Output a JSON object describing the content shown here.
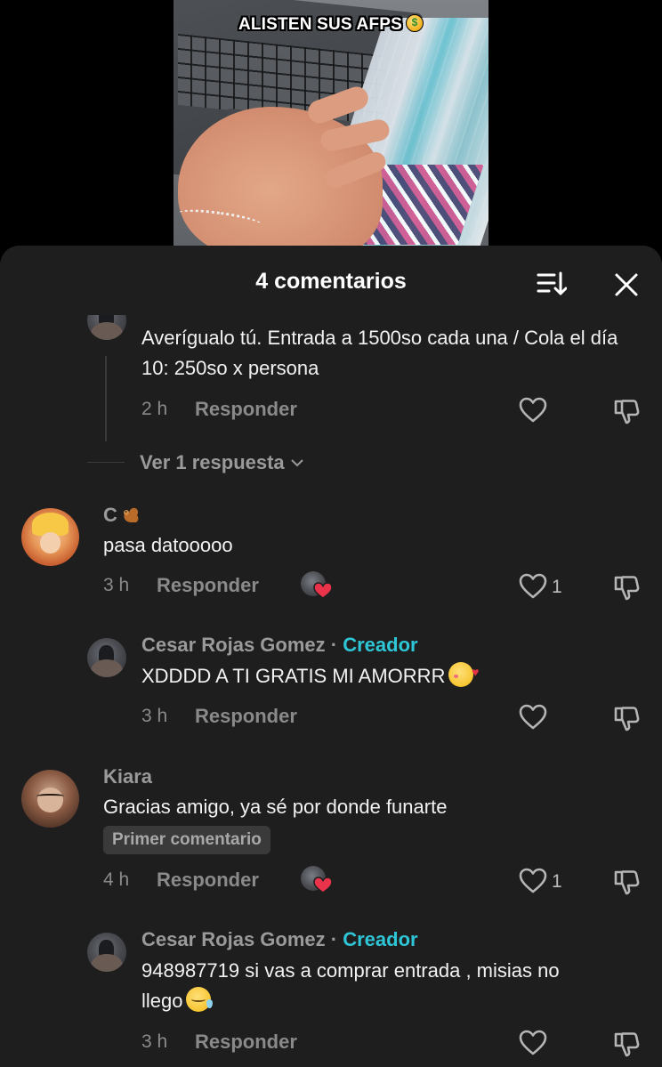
{
  "video": {
    "caption": "ALISTEN SUS AFPS",
    "caption_emoji": "money-mouth-face"
  },
  "sheet": {
    "title": "4 comentarios",
    "sort_icon": "sort-icon",
    "close_icon": "close-icon"
  },
  "comments": [
    {
      "id": "reply-top",
      "text": "Averígualo tú. Entrada a 1500so cada una / Cola el día 10: 250so x persona",
      "time": "2 h",
      "reply_label": "Responder"
    },
    {
      "id": "view-replies",
      "label": "Ver 1 respuesta"
    },
    {
      "id": "comment-c",
      "username": "C",
      "username_emoji": "squirrel",
      "text": "pasa datooooo",
      "time": "3 h",
      "reply_label": "Responder",
      "likes": "1",
      "liked_by_creator": true
    },
    {
      "id": "reply-cesar-1",
      "username": "Cesar Rojas Gomez",
      "separator": "·",
      "creator_label": "Creador",
      "text": "XDDDD A TI GRATIS MI AMORRR",
      "text_emoji": "smiling-face-with-hearts",
      "time": "3 h",
      "reply_label": "Responder"
    },
    {
      "id": "comment-kiara",
      "username": "Kiara",
      "text": "Gracias amigo, ya sé por donde funarte",
      "badge": "Primer comentario",
      "time": "4 h",
      "reply_label": "Responder",
      "likes": "1",
      "liked_by_creator": true
    },
    {
      "id": "reply-cesar-2",
      "username": "Cesar Rojas Gomez",
      "separator": "·",
      "creator_label": "Creador",
      "text_line1": "948987719 si vas a comprar entrada , misias no",
      "text_line2": "llego",
      "text_emoji": "sleepy-face",
      "time": "3 h",
      "reply_label": "Responder"
    }
  ],
  "colors": {
    "background": "#000000",
    "sheet": "#1e1e1e",
    "creator_tag": "#2ec5d6",
    "secondary_text": "#8a8a8a",
    "heart_red": "#e8334a"
  }
}
